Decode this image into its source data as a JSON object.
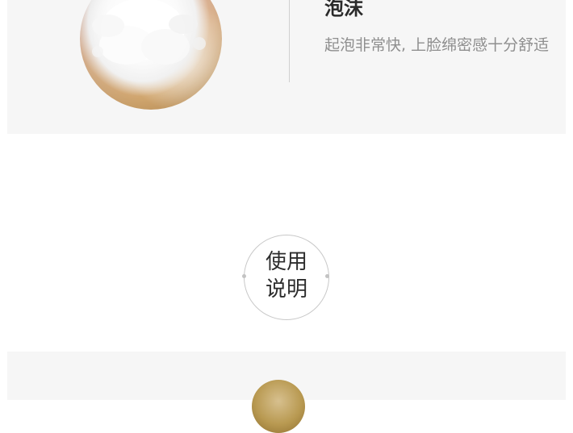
{
  "feature": {
    "title": "泡沫",
    "description": "起泡非常快, 上脸绵密感十分舒适"
  },
  "section": {
    "line1": "使用",
    "line2": "说明"
  },
  "colors": {
    "panel_background": "#f6f6f6",
    "title_text": "#2a2a2a",
    "description_text": "#8f8f8f",
    "badge_border": "#c8c8c8"
  }
}
